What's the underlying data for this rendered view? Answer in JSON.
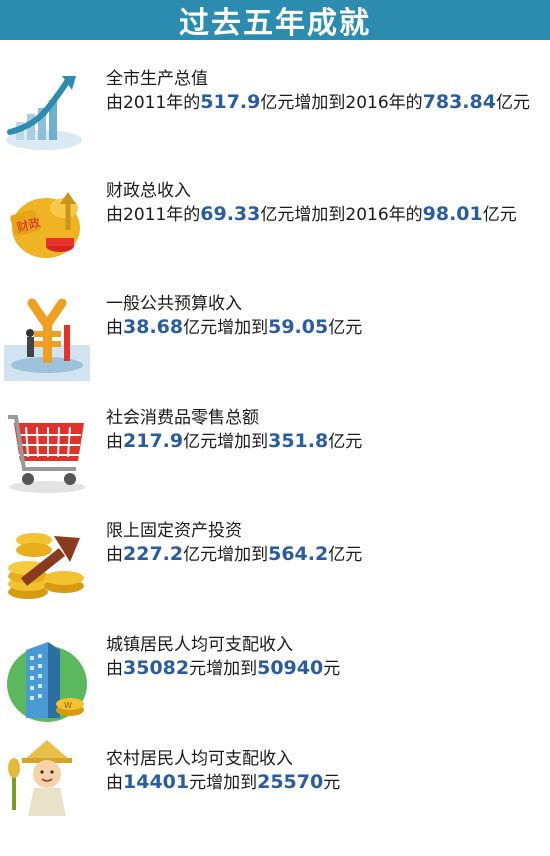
{
  "banner": {
    "title": "过去五年成就"
  },
  "colors": {
    "banner": "#2b8cb0",
    "number": "#2a5da0",
    "text": "#1a1a1a"
  },
  "items": [
    {
      "icon": "growth-chart-icon",
      "heading": "全市生产总值",
      "prefix": "由2011年的",
      "from": "517.9",
      "middle": "亿元增加到2016年的",
      "to": "783.84",
      "suffix": "亿元"
    },
    {
      "icon": "finance-piggy-icon",
      "heading": "财政总收入",
      "prefix": "由2011年的",
      "from": "69.33",
      "middle": "亿元增加到2016年的",
      "to": "98.01",
      "suffix": "亿元"
    },
    {
      "icon": "yuan-sign-icon",
      "heading": "一般公共预算收入",
      "prefix": "由",
      "from": "38.68",
      "middle": "亿元增加到",
      "to": "59.05",
      "suffix": "亿元"
    },
    {
      "icon": "shopping-cart-icon",
      "heading": "社会消费品零售总额",
      "prefix": "由",
      "from": "217.9",
      "middle": "亿元增加到",
      "to": "351.8",
      "suffix": "亿元"
    },
    {
      "icon": "coins-arrow-icon",
      "heading": "限上固定资产投资",
      "prefix": "由",
      "from": "227.2",
      "middle": "亿元增加到",
      "to": "564.2",
      "suffix": "亿元"
    },
    {
      "icon": "city-building-icon",
      "heading": "城镇居民人均可支配收入",
      "prefix": "由",
      "from": "35082",
      "middle": "元增加到",
      "to": "50940",
      "suffix": "元"
    },
    {
      "icon": "farmer-icon",
      "heading": "农村居民人均可支配收入",
      "prefix": "由",
      "from": "14401",
      "middle": "元增加到",
      "to": "25570",
      "suffix": "元"
    }
  ]
}
